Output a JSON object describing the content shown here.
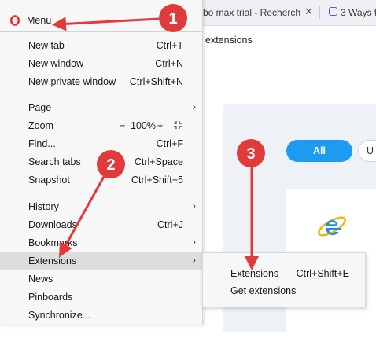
{
  "browser": {
    "tabs": [
      {
        "title": "bo max trial - Recherch"
      },
      {
        "title": "3 Ways t"
      }
    ],
    "address": "extensions"
  },
  "extensions_page": {
    "filters": [
      "All",
      "U"
    ]
  },
  "menu": {
    "title": "Menu",
    "groups": [
      [
        {
          "label": "New tab",
          "shortcut": "Ctrl+T"
        },
        {
          "label": "New window",
          "shortcut": "Ctrl+N"
        },
        {
          "label": "New private window",
          "shortcut": "Ctrl+Shift+N"
        }
      ],
      [
        {
          "label": "Page",
          "submenu": true
        },
        {
          "label": "Zoom",
          "zoom": {
            "minus": "−",
            "value": "100%",
            "plus": "+"
          }
        },
        {
          "label": "Find...",
          "shortcut": "Ctrl+F"
        },
        {
          "label": "Search tabs",
          "shortcut": "Ctrl+Space"
        },
        {
          "label": "Snapshot",
          "shortcut": "Ctrl+Shift+5"
        }
      ],
      [
        {
          "label": "History",
          "submenu": true
        },
        {
          "label": "Downloads",
          "shortcut": "Ctrl+J"
        },
        {
          "label": "Bookmarks",
          "submenu": true
        },
        {
          "label": "Extensions",
          "submenu": true,
          "highlighted": true
        },
        {
          "label": "News"
        },
        {
          "label": "Pinboards"
        },
        {
          "label": "Synchronize..."
        }
      ]
    ]
  },
  "extensions_submenu": [
    {
      "label": "Extensions",
      "shortcut": "Ctrl+Shift+E"
    },
    {
      "label": "Get extensions"
    }
  ],
  "annotations": [
    {
      "number": "1"
    },
    {
      "number": "2"
    },
    {
      "number": "3"
    }
  ],
  "colors": {
    "annotation": "#e03a3a",
    "accent": "#1d9bf0",
    "opera_red": "#ff1b2d"
  }
}
